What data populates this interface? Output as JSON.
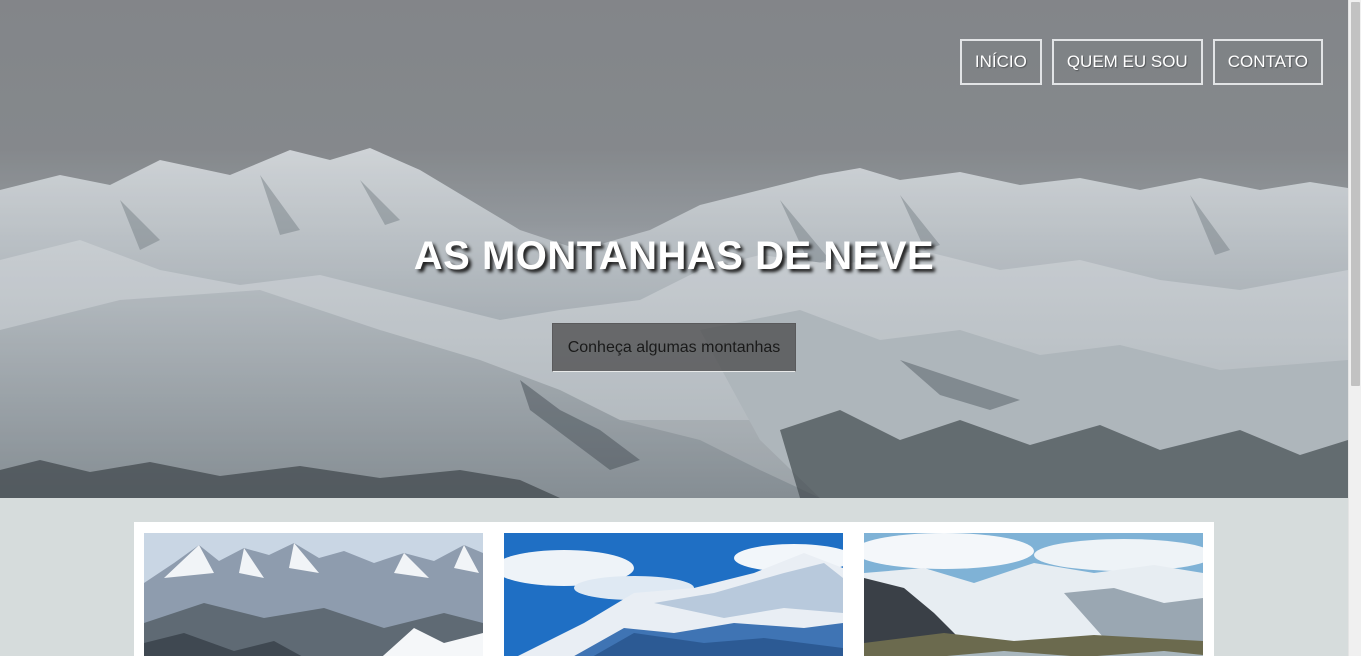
{
  "nav": {
    "items": [
      {
        "label": "INÍCIO"
      },
      {
        "label": "QUEM EU SOU"
      },
      {
        "label": "CONTATO"
      }
    ]
  },
  "hero": {
    "title": "AS MONTANHAS DE NEVE",
    "cta_label": "Conheça algumas montanhas"
  },
  "gallery": {
    "cards": [
      {
        "image": "snowy-peaks-photo"
      },
      {
        "image": "blue-sky-snow-ridge-photo"
      },
      {
        "image": "glacier-valley-photo"
      }
    ]
  },
  "colors": {
    "page_background": "#d6dcdc",
    "card_panel": "#ffffff",
    "nav_border": "#e2e4e6",
    "cta_background": "#4e4e50"
  }
}
